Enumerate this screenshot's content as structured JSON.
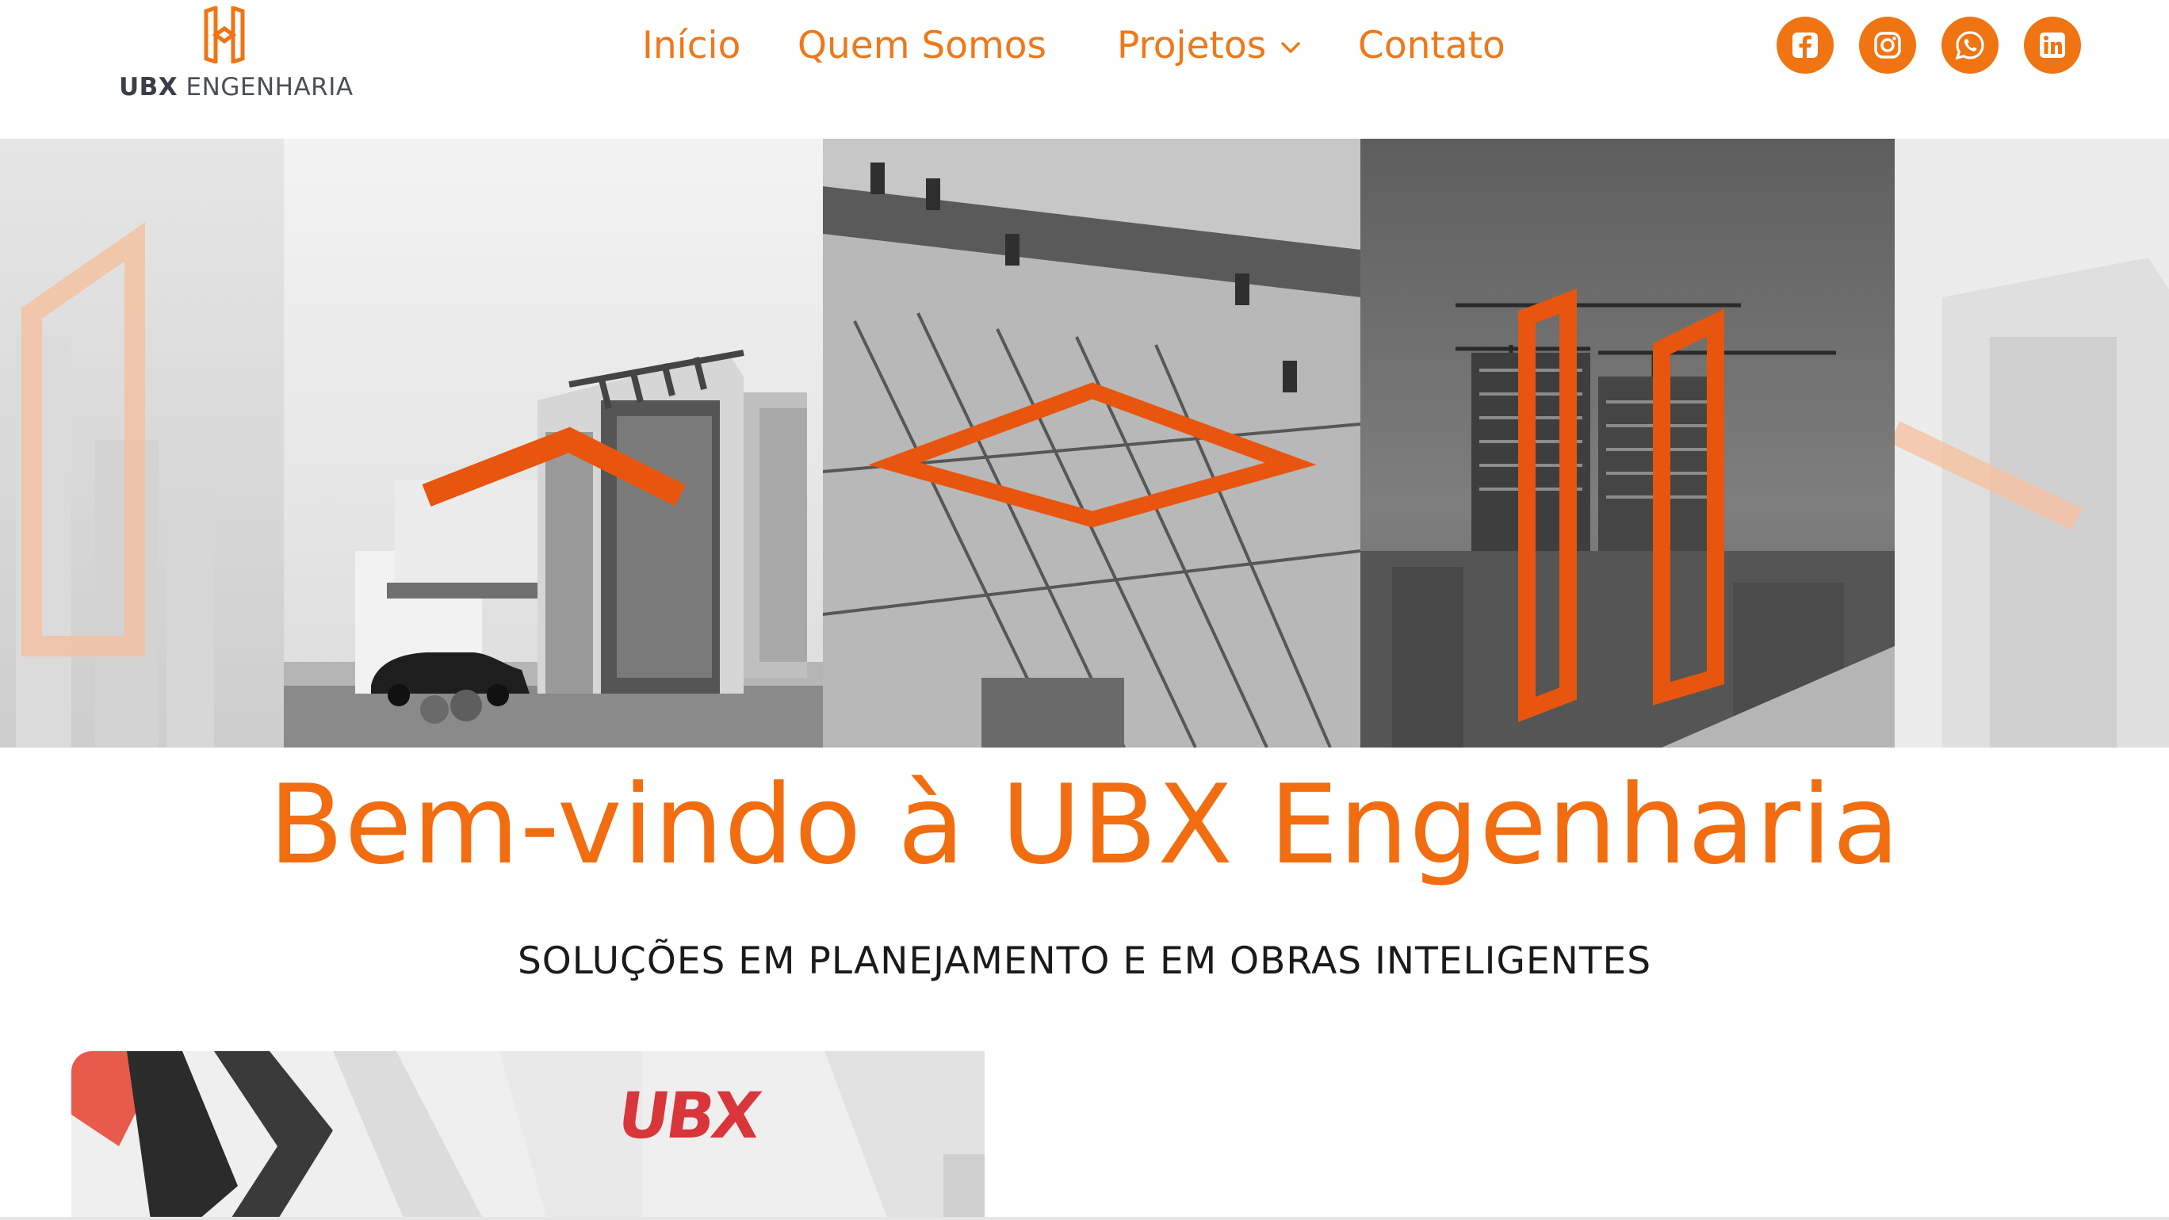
{
  "brand": {
    "name_bold": "UBX",
    "name_rest": " ENGENHARIA",
    "logo_icon": "ubx-logo-mark",
    "accent_color": "#f07412"
  },
  "nav": {
    "items": [
      {
        "label": "Início"
      },
      {
        "label": "Quem Somos"
      },
      {
        "label": "Projetos",
        "icon": "chevron-down-icon"
      },
      {
        "label": "Contato"
      }
    ]
  },
  "social": [
    {
      "icon": "facebook-icon"
    },
    {
      "icon": "instagram-icon"
    },
    {
      "icon": "whatsapp-icon"
    },
    {
      "icon": "linkedin-icon"
    }
  ],
  "hero": {
    "panels": [
      {
        "subject": "modern-house",
        "overlay": "orange-roof-shape"
      },
      {
        "subject": "construction-site-aerial",
        "overlay": "orange-diamond-shape"
      },
      {
        "subject": "high-rise-towers-cranes",
        "overlay": "orange-bracket-shapes"
      }
    ]
  },
  "welcome": {
    "title": "Bem-vindo à UBX Engenharia",
    "subtitle": "SOLUÇÕES EM PLANEJAMENTO E EM OBRAS INTELIGENTES"
  },
  "promo": {
    "sign_text": "UBX"
  }
}
